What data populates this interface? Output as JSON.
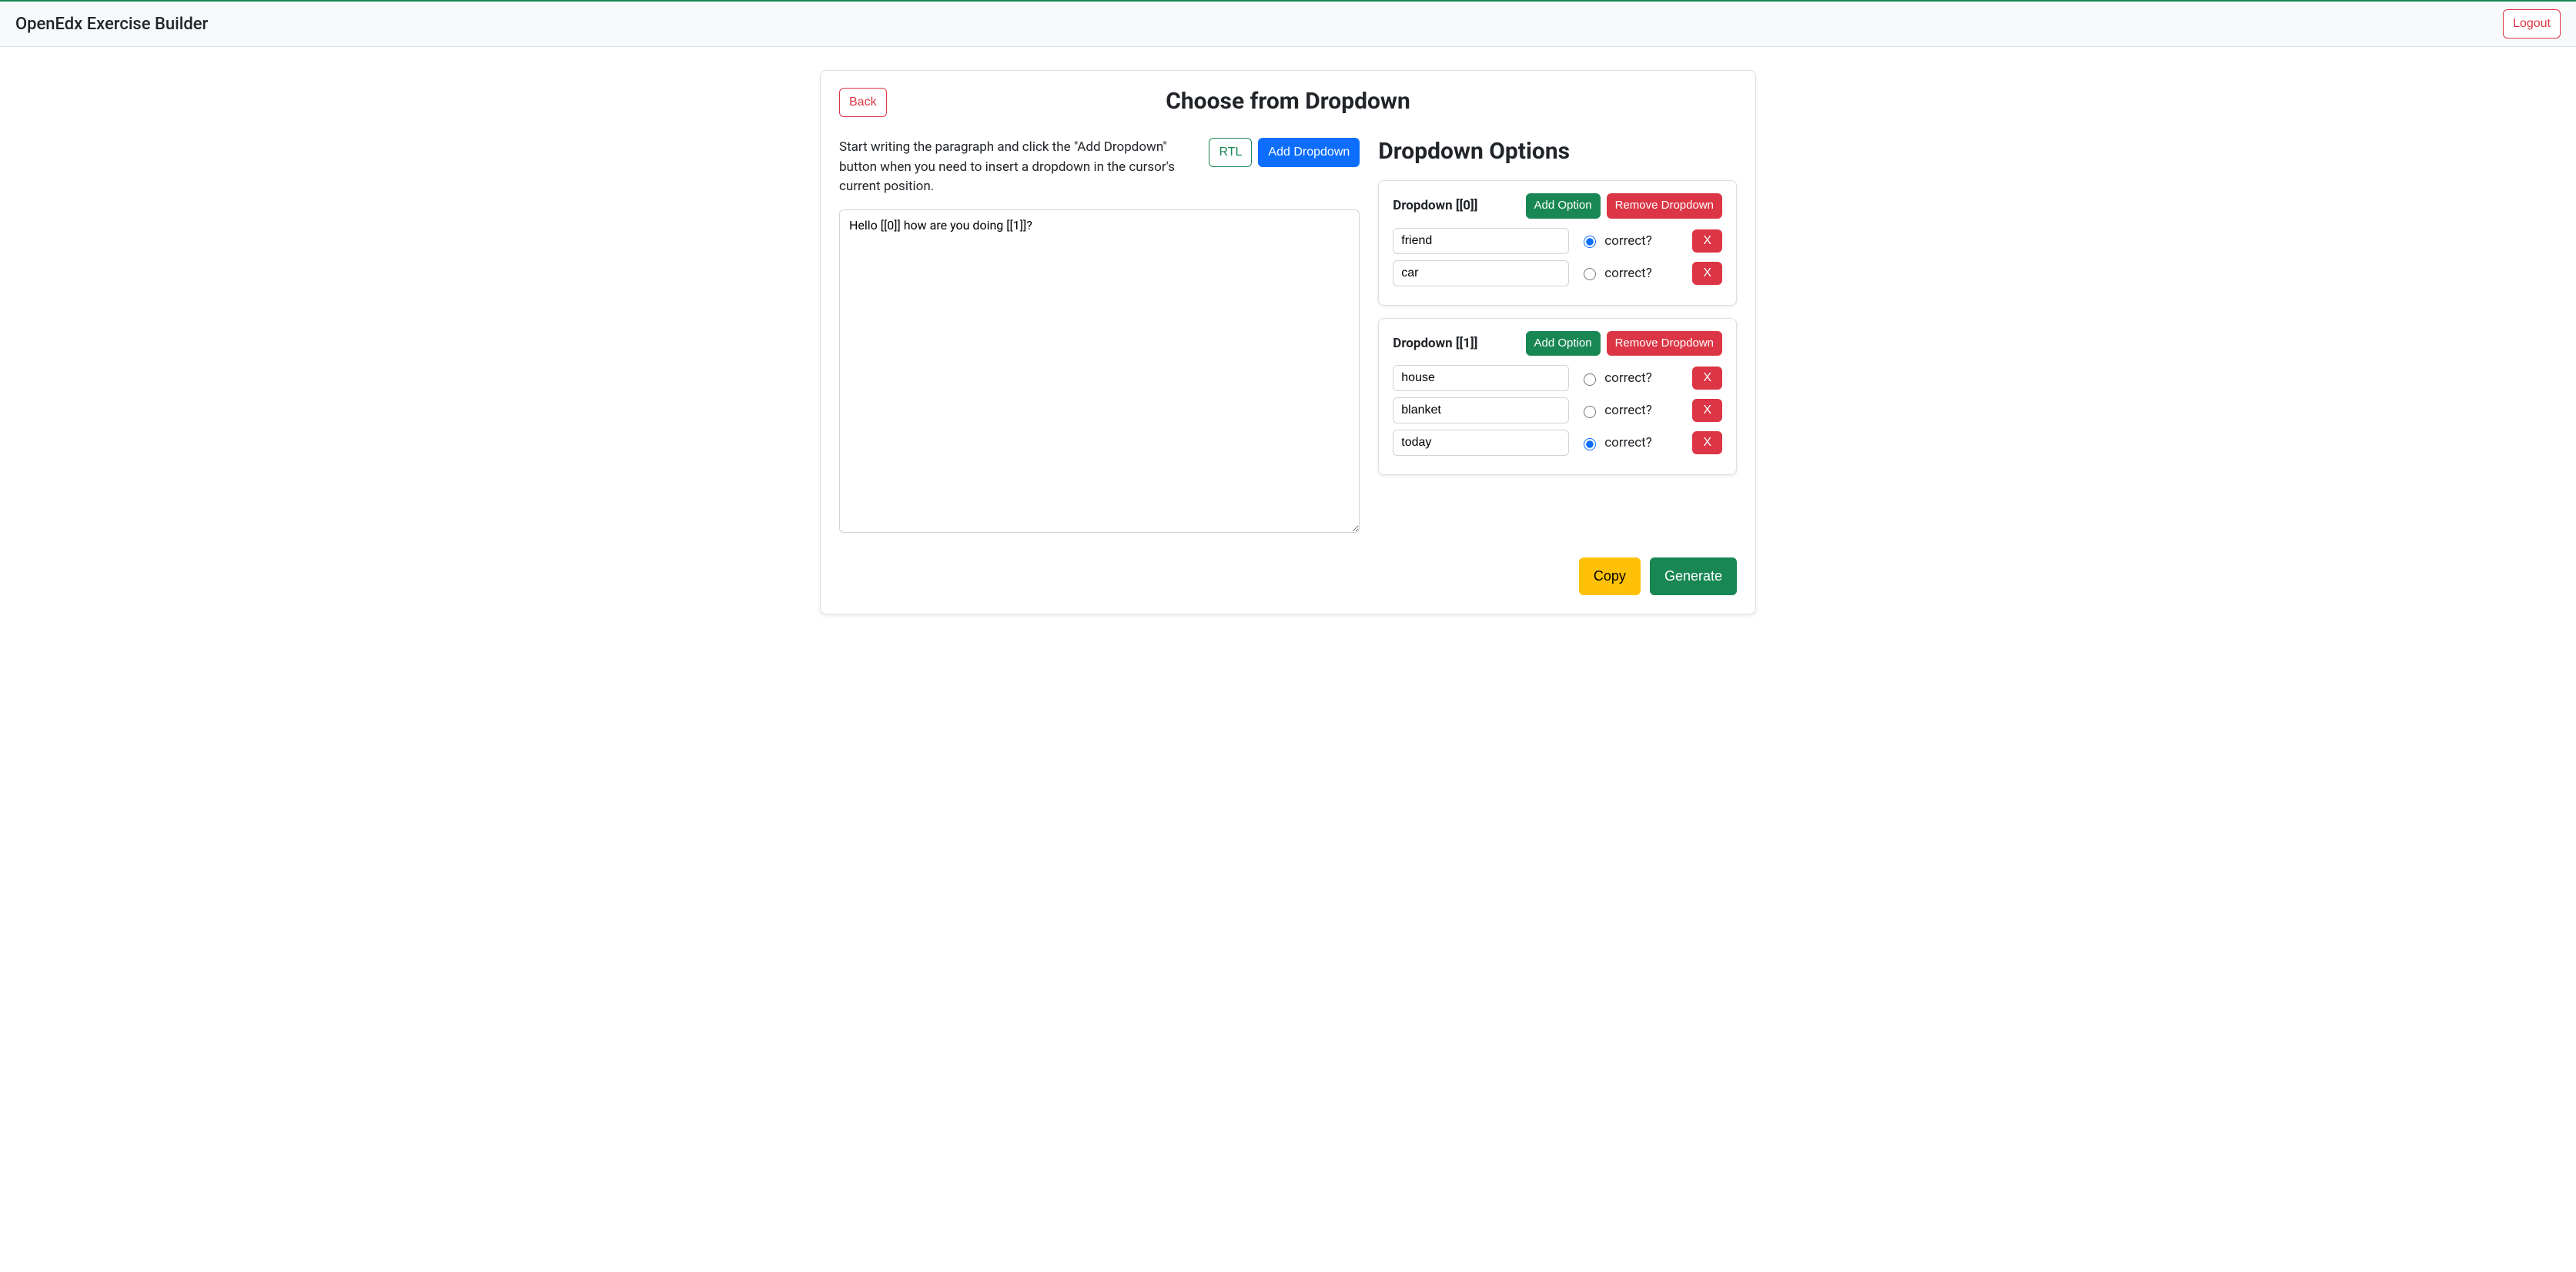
{
  "navbar": {
    "brand": "OpenEdx Exercise Builder",
    "logout": "Logout"
  },
  "page": {
    "back": "Back",
    "title": "Choose from Dropdown"
  },
  "editor": {
    "instructions": "Start writing the paragraph and click the \"Add Dropdown\" button when you need to insert a dropdown in the cursor's current position.",
    "rtl": "RTL",
    "add_dropdown": "Add Dropdown",
    "textarea_value": "Hello [[0]] how are you doing [[1]]?"
  },
  "options_panel": {
    "title": "Dropdown Options",
    "correct_label": "correct?",
    "add_option": "Add Option",
    "remove_dropdown": "Remove Dropdown",
    "delete_x": "X",
    "dropdowns": [
      {
        "label": "Dropdown [[0]]",
        "options": [
          {
            "value": "friend",
            "correct": true
          },
          {
            "value": "car",
            "correct": false
          }
        ]
      },
      {
        "label": "Dropdown [[1]]",
        "options": [
          {
            "value": "house",
            "correct": false
          },
          {
            "value": "blanket",
            "correct": false
          },
          {
            "value": "today",
            "correct": true
          }
        ]
      }
    ]
  },
  "footer": {
    "copy": "Copy",
    "generate": "Generate"
  }
}
